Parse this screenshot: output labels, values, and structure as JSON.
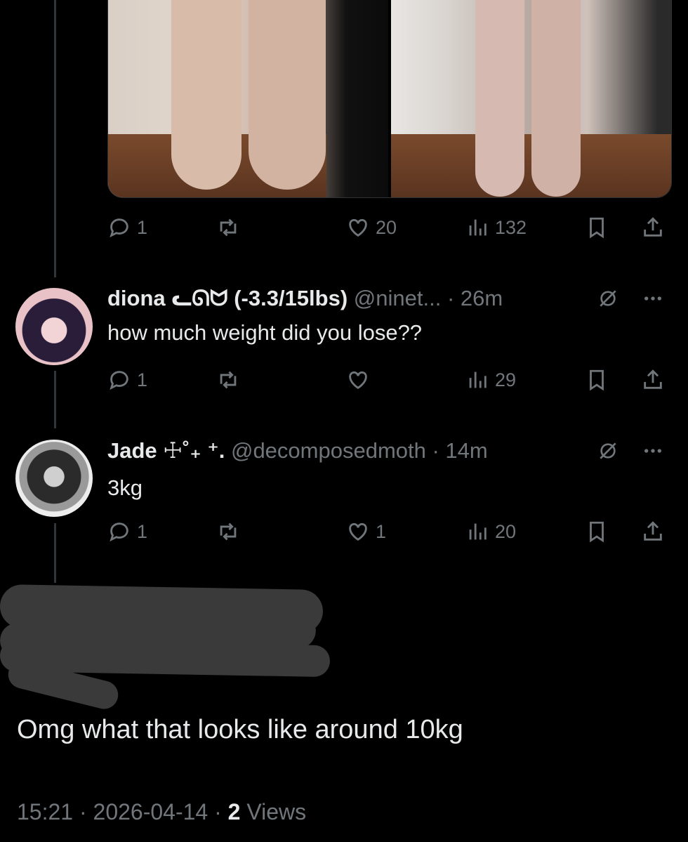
{
  "post": {
    "stats": {
      "replies": "1",
      "likes": "20",
      "views": "132"
    }
  },
  "replies": [
    {
      "name": "diona ᓚᘏᗢ (-3.3/15lbs)",
      "handle": "@ninet...",
      "time": "· 26m",
      "text": "how much weight did you lose??",
      "stats": {
        "replies": "1",
        "likes": "",
        "views": "29"
      }
    },
    {
      "name": "Jade ☩˚₊ ⁺.",
      "handle": "@decomposedmoth",
      "time": "· 14m",
      "text": "3kg",
      "stats": {
        "replies": "1",
        "likes": "1",
        "views": "20"
      }
    }
  ],
  "main_post": {
    "text": "Omg what that looks like around 10kg",
    "time": "15:21 · 2026-04-14 · ",
    "views_count": "2",
    "views_label": " Views"
  },
  "icons": [
    "reply-icon",
    "retweet-icon",
    "like-icon",
    "views-icon",
    "bookmark-icon",
    "share-icon",
    "grok-icon",
    "more-icon"
  ]
}
